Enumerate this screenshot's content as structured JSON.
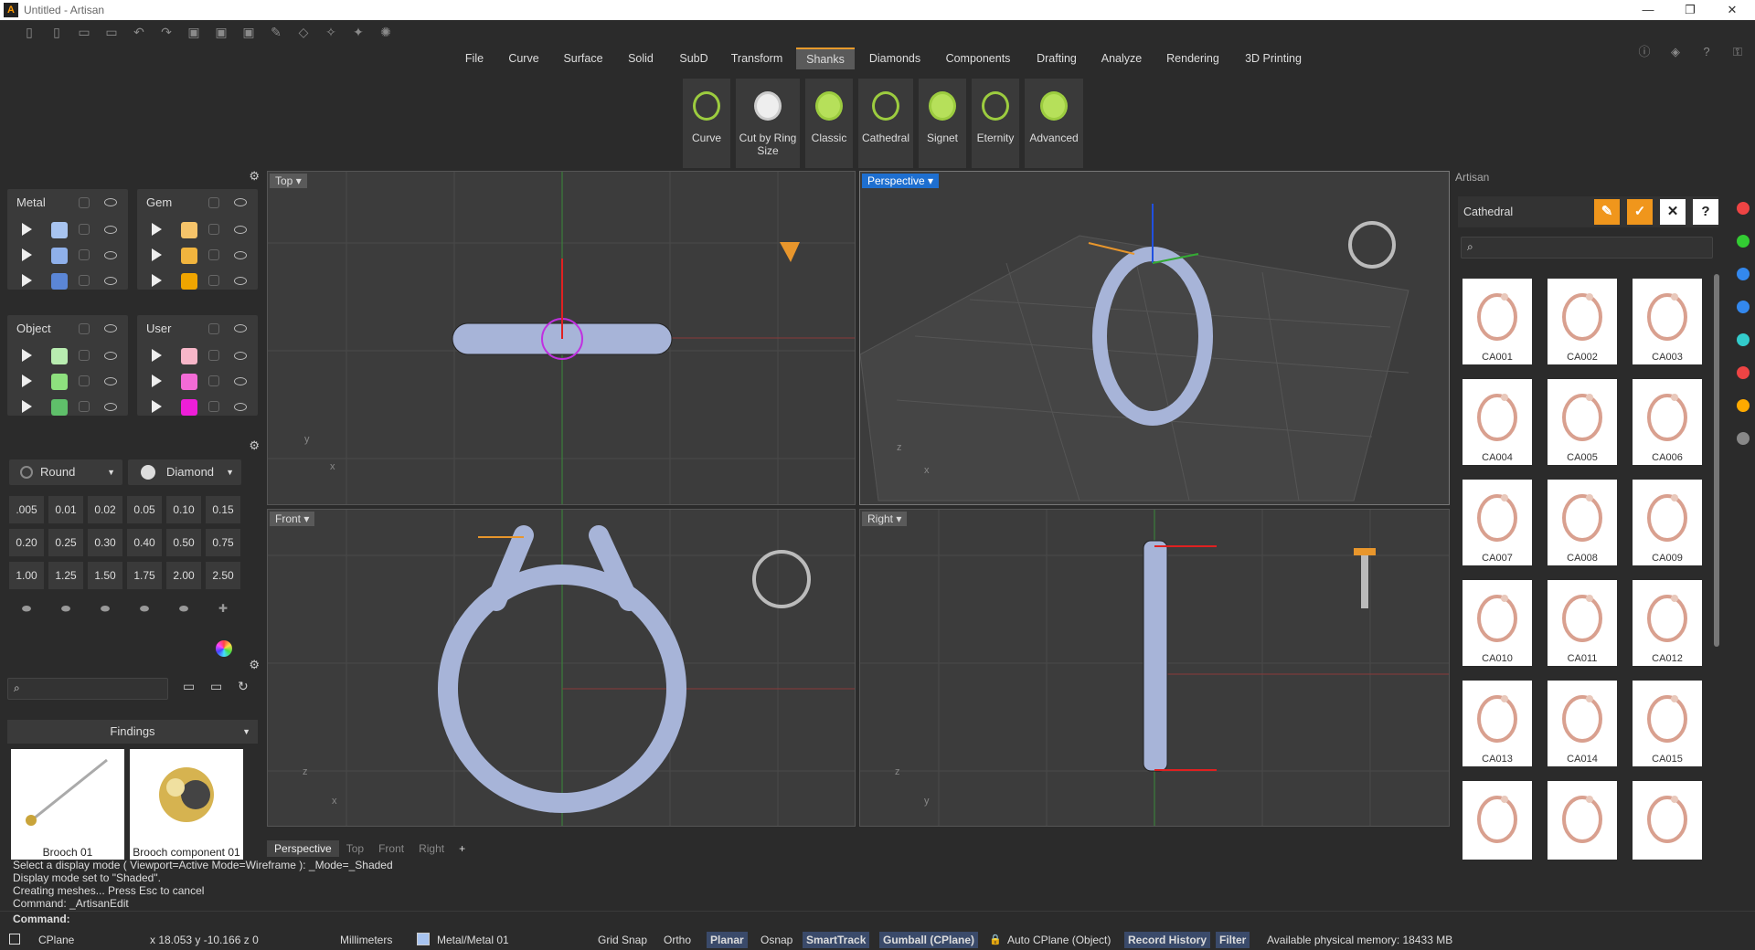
{
  "window": {
    "title": "Untitled - Artisan",
    "controls": {
      "minimize": "—",
      "restore": "❐",
      "close": "✕"
    }
  },
  "menu": {
    "items": [
      "File",
      "Curve",
      "Surface",
      "Solid",
      "SubD",
      "Transform",
      "Shanks",
      "Diamonds",
      "Components",
      "Drafting",
      "Analyze",
      "Rendering",
      "3D Printing"
    ],
    "active": "Shanks"
  },
  "ribbon": {
    "buttons": [
      {
        "label": "Curve",
        "icon": "curve-shank-icon"
      },
      {
        "label": "Cut by Ring Size",
        "icon": "cut-ring-icon"
      },
      {
        "label": "Classic",
        "icon": "classic-shank-icon"
      },
      {
        "label": "Cathedral",
        "icon": "cathedral-shank-icon"
      },
      {
        "label": "Signet",
        "icon": "signet-shank-icon"
      },
      {
        "label": "Eternity",
        "icon": "eternity-shank-icon"
      },
      {
        "label": "Advanced",
        "icon": "advanced-shank-icon"
      }
    ]
  },
  "layers": {
    "metal": {
      "title": "Metal",
      "colors": [
        "#a8c4f0",
        "#8fb0ea",
        "#5b86d6"
      ]
    },
    "gem": {
      "title": "Gem",
      "colors": [
        "#f6c46a",
        "#f1b43e",
        "#f0a500"
      ]
    },
    "object": {
      "title": "Object",
      "colors": [
        "#b8ecb0",
        "#8ee07e",
        "#5fbf6a"
      ]
    },
    "user": {
      "title": "User",
      "colors": [
        "#f7b6c8",
        "#f36bd6",
        "#ee1ed8"
      ]
    }
  },
  "gems": {
    "cut": "Round",
    "material": "Diamond",
    "sizes": [
      ".005",
      "0.01",
      "0.02",
      "0.05",
      "0.10",
      "0.15",
      "0.20",
      "0.25",
      "0.30",
      "0.40",
      "0.50",
      "0.75",
      "1.00",
      "1.25",
      "1.50",
      "1.75",
      "2.00",
      "2.50"
    ]
  },
  "library": {
    "search_placeholder": "",
    "category": "Findings",
    "items": [
      "Brooch 01",
      "Brooch component 01"
    ]
  },
  "viewports": {
    "top": "Top",
    "perspective": "Perspective",
    "front": "Front",
    "right": "Right"
  },
  "viewport_tabs": [
    "Perspective",
    "Top",
    "Front",
    "Right",
    "+"
  ],
  "artisan": {
    "panel_title": "Artisan",
    "header": "Cathedral",
    "search_placeholder": "",
    "items": [
      "CA001",
      "CA002",
      "CA003",
      "CA004",
      "CA005",
      "CA006",
      "CA007",
      "CA008",
      "CA009",
      "CA010",
      "CA011",
      "CA012",
      "CA013",
      "CA014",
      "CA015",
      "",
      "",
      ""
    ]
  },
  "command": {
    "history": [
      "Select a display mode ( Viewport=Active  Mode=Wireframe ): _Mode=_Shaded",
      "Display mode set to \"Shaded\".",
      "Creating meshes... Press Esc to cancel",
      "Command: _ArtisanEdit"
    ],
    "prompt": "Command:"
  },
  "status": {
    "cplane": "CPlane",
    "coords": "x 18.053  y -10.166  z 0",
    "units": "Millimeters",
    "layer": "Metal/Metal 01",
    "layer_color": "#a8c4f0",
    "grid_snap": "Grid Snap",
    "ortho": "Ortho",
    "planar": "Planar",
    "osnap": "Osnap",
    "smarttrack": "SmartTrack",
    "gumball": "Gumball (CPlane)",
    "autocplane": "Auto CPlane (Object)",
    "record": "Record History",
    "filter": "Filter",
    "memory": "Available physical memory: 18433 MB"
  }
}
